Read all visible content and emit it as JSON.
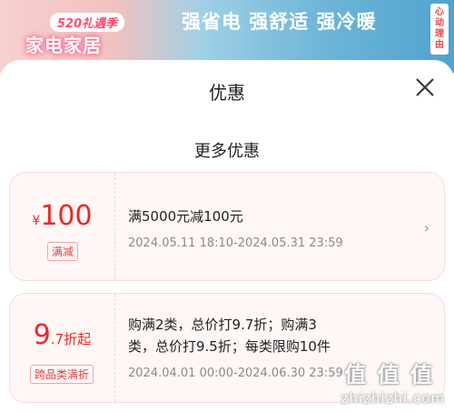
{
  "banner": {
    "badge": "520礼遇季",
    "title": "家电家居",
    "slogan": "强省电 强舒适 强冷暖",
    "side_text": "心动理由"
  },
  "sheet": {
    "title": "优惠",
    "section_title": "更多优惠"
  },
  "coupons": [
    {
      "currency": "¥",
      "amount": "100",
      "tag": "满减",
      "desc": "满5000元减100元",
      "time": "2024.05.11 18:10-2024.05.31 23:59"
    },
    {
      "amount": "9",
      "amount_suffix": ".7折起",
      "tag": "跨品类满折",
      "desc_line1": "购满2类，总价打9.7折；购满3",
      "desc_line2": "类，总价打9.5折；每类限购10件",
      "time": "2024.04.01 00:00-2024.06.30 23:59"
    }
  ],
  "watermark": {
    "logo": "值 值 值",
    "text": "zhizhizhi.com"
  }
}
